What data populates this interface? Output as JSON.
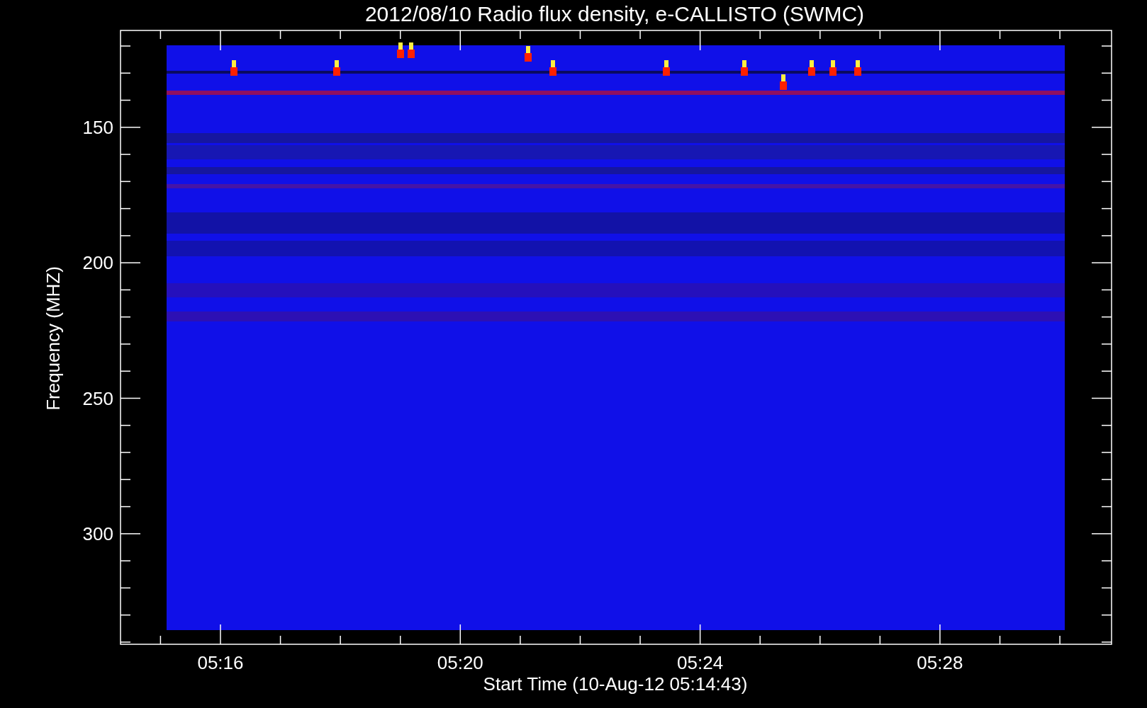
{
  "title": "2012/08/10  Radio flux density, e-CALLISTO (SWMC)",
  "ylabel": "Frequency (MHZ)",
  "xlabel": "Start Time (10-Aug-12 05:14:43)",
  "yticks": [
    {
      "label": "150"
    },
    {
      "label": "200"
    },
    {
      "label": "250"
    },
    {
      "label": "300"
    }
  ],
  "xticks": [
    {
      "label": "05:16"
    },
    {
      "label": "05:20"
    },
    {
      "label": "05:24"
    },
    {
      "label": "05:28"
    }
  ]
}
